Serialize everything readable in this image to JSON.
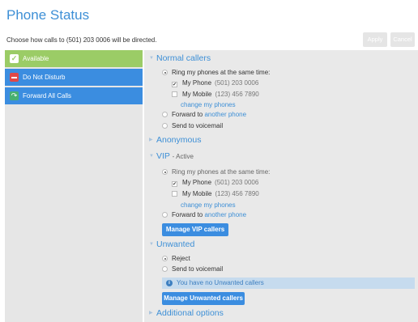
{
  "page": {
    "title": "Phone Status",
    "subtitle": "Choose how calls to (501) 203 0006 will be directed."
  },
  "toolbar": {
    "apply_label": "Apply",
    "cancel_label": "Cancel"
  },
  "sidebar": {
    "items": [
      {
        "label": "Available",
        "icon": "check-icon",
        "color": "#9bcc66"
      },
      {
        "label": "Do Not Disturb",
        "icon": "no-entry-icon",
        "color": "#3b8de0"
      },
      {
        "label": "Forward All Calls",
        "icon": "forward-icon",
        "color": "#3b8de0"
      }
    ]
  },
  "normal": {
    "header": "Normal callers",
    "ring_all_label": "Ring my phones at the same time:",
    "phone1_label": "My Phone",
    "phone1_number": "(501) 203 0006",
    "phone2_label": "My Mobile",
    "phone2_number": "(123) 456 7890",
    "change_link": "change my phones",
    "forward_prefix": "Forward to",
    "forward_link": "another phone",
    "voicemail_label": "Send to voicemail"
  },
  "anonymous": {
    "header": "Anonymous"
  },
  "vip": {
    "header": "VIP",
    "status": "- Active",
    "ring_all_label": "Ring my phones at the same time:",
    "phone1_label": "My Phone",
    "phone1_number": "(501) 203 0006",
    "phone2_label": "My Mobile",
    "phone2_number": "(123) 456 7890",
    "change_link": "change my phones",
    "forward_prefix": "Forward to",
    "forward_link": "another phone",
    "manage_label": "Manage VIP callers"
  },
  "unwanted": {
    "header": "Unwanted",
    "reject_label": "Reject",
    "voicemail_label": "Send to voicemail",
    "info_text": "You have no Unwanted callers",
    "manage_label": "Manage Unwanted callers"
  },
  "additional": {
    "header": "Additional options"
  }
}
